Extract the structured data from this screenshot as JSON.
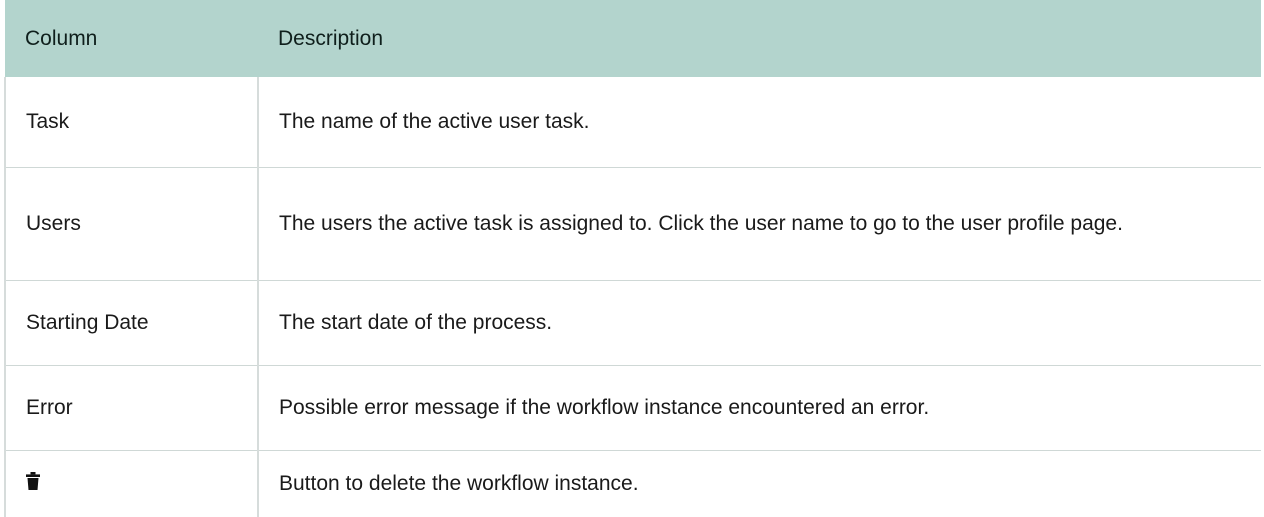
{
  "table": {
    "headers": [
      "Column",
      "Description"
    ],
    "rows": [
      {
        "column": "Task",
        "description": "The name of the active user task."
      },
      {
        "column": "Users",
        "description": "The users the active task is assigned to. Click the user name to go to the user profile page."
      },
      {
        "column": "Starting Date",
        "description": "The start date of the process."
      },
      {
        "column": "Error",
        "description": "Possible error message if the workflow instance encountered an error."
      },
      {
        "column_icon": "trash-icon",
        "description": "Button to delete the workflow instance."
      }
    ]
  },
  "colors": {
    "header_background": "#b3d4cd",
    "text": "#1a1a1a"
  }
}
